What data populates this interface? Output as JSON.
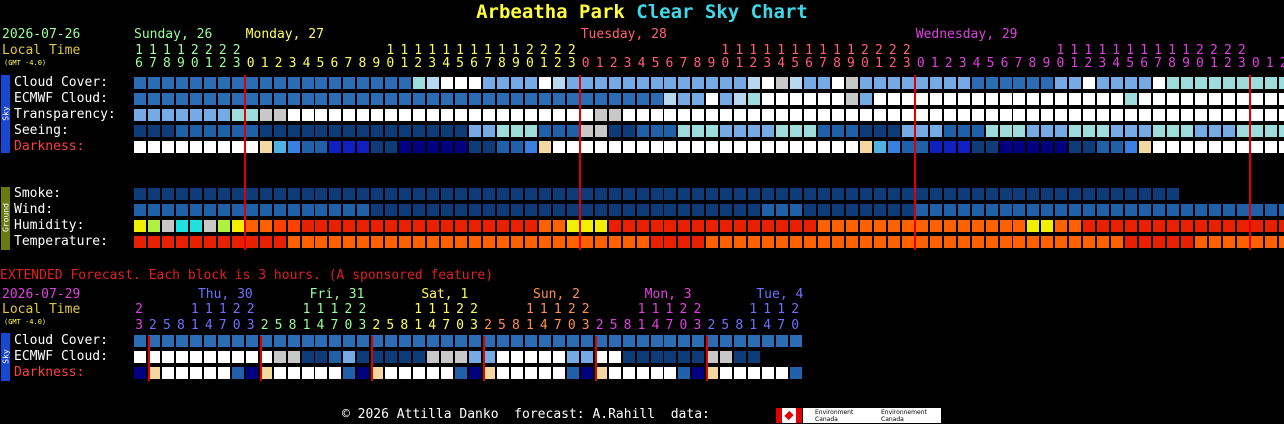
{
  "title": {
    "park": "Arbeatha Park",
    "chart": "Clear Sky Chart"
  },
  "main": {
    "date": "2026-07-26",
    "local_time": "Local Time",
    "gmt": "(GMT -4.0)",
    "days": [
      {
        "label": "Sunday, 26",
        "color": "#9cff9c"
      },
      {
        "label": "Monday, 27",
        "color": "#ffff60"
      },
      {
        "label": "Tuesday, 28",
        "color": "#ff6070"
      },
      {
        "label": "Wednesday, 29",
        "color": "#e040e0"
      }
    ],
    "hours": [
      16,
      17,
      18,
      19,
      20,
      21,
      22,
      23,
      0,
      1,
      2,
      3,
      4,
      5,
      6,
      7,
      8,
      9,
      10,
      11,
      12,
      13,
      14,
      15,
      16,
      17,
      18,
      19,
      20,
      21,
      22,
      23,
      0,
      1,
      2,
      3,
      4,
      5,
      6,
      7,
      8,
      9,
      10,
      11,
      12,
      13,
      14,
      15,
      16,
      17,
      18,
      19,
      20,
      21,
      22,
      23,
      0,
      1,
      2,
      3,
      4,
      5,
      6,
      7,
      8,
      9,
      10,
      11,
      12,
      13,
      14,
      15,
      16,
      17,
      18,
      19,
      20,
      21,
      22,
      23,
      0,
      1,
      2,
      3,
      4,
      5,
      6,
      7,
      8,
      9,
      10,
      11,
      12,
      13,
      14,
      15,
      16,
      17,
      18,
      19,
      20
    ],
    "day_index": [
      0,
      0,
      0,
      0,
      0,
      0,
      0,
      0,
      1,
      1,
      1,
      1,
      1,
      1,
      1,
      1,
      1,
      1,
      1,
      1,
      1,
      1,
      1,
      1,
      1,
      1,
      1,
      1,
      1,
      1,
      1,
      1,
      2,
      2,
      2,
      2,
      2,
      2,
      2,
      2,
      2,
      2,
      2,
      2,
      2,
      2,
      2,
      2,
      2,
      2,
      2,
      2,
      2,
      2,
      2,
      2,
      3,
      3,
      3,
      3,
      3,
      3,
      3,
      3,
      3,
      3,
      3,
      3,
      3,
      3,
      3,
      3,
      3,
      3,
      3,
      3,
      3,
      3,
      3,
      3,
      3,
      3,
      3,
      3,
      3,
      3,
      3,
      3,
      3,
      3,
      3,
      3,
      3,
      3,
      3,
      3,
      3,
      3,
      3,
      3,
      3,
      3,
      3
    ],
    "sky_label": "Sky",
    "ground_label": "Ground",
    "sky_rows": [
      {
        "label": "Cloud Cover:",
        "color": "#ffffff",
        "cells": "BBBBBBBBBBBBBBBBBBBBTSWWWLLLLWSLLLLLLLLLLLLLSWGSLLWGLLLLLLLLBBBBBBLLWLLLLWTTTTTTTTTTTTTTWWTTTTTTTTTTTTTWWWWWLGWWWWWWTLTLTLTLTL"
      },
      {
        "label": "ECMWF Cloud:",
        "color": "#ffffff",
        "cells": "BBBBBBBBBBBBBBBBBBBBBBBBBBBBBBBBBBBBBBSLLWLSTWWWWWWGLWWWWWWWWWWWWWWWWWWTWWWWWWWWWWWWWWWWWWWWWWWWWWWWWWWWWWWWWWWWWWWW"
      },
      {
        "label": "Transparency:",
        "color": "#ffffff",
        "cells": "LLLLLLLTTGGWWWWWWWWWWWWWWWWWWWWWWGGWWWWWWWWWWWWWWWWWWWWWWWWWWWWWWWWWWWWWWWWWWWWWWWWWWWWWWWWWWWWWWWWWWWWWWWWWWWWWWWGW"
      },
      {
        "label": "Seeing:",
        "color": "#ffffff",
        "cells": "DDDMMMMMMDDDDDDDDDDDDDDDLLTTTMMMGGDDMMMTTTLLLLTTTMMMDDDLLLMMMTTTLLLTTTLLLTTTLLLTTTTTTTT"
      },
      {
        "label": "Darkness:",
        "color": "#ff4040",
        "cells": "WWWWWWWWWPVaMMNNNDDXXXXXDDMMaPWWWWWWWWWWWWWWWWWWWWWWPVaMMNNNDDXXXXXDDMMaPWWWWWWWWWWWWWWWWWWWWWWPVaMMNNNDDXXXXXDDMMaPWWWWWWWWWWWWWWWWWWWWP"
      }
    ],
    "ground_rows": [
      {
        "label": "Smoke:",
        "color": "#ffffff",
        "cells": "DDDDDDDDDDDDDDDDDDDDDDDDDDDDDDDDDDDDDDDDDDDDDDDDDDDDDDDDDDDDDDDDDDDDDDDDDDD"
      },
      {
        "label": "Wind:",
        "color": "#ffffff",
        "cells": "MMMMMMMMMMMMMMMMMDDDDDDDDDDDDDDDDDDDDDDDDDDDDMMMDDDDDDDDMMMMMMMMMMMMMMMMMMMMMMMMMMMMMMMMMMMMMMMMMMMMMMMMMMM"
      },
      {
        "label": "Humidity:",
        "color": "#ffffff",
        "cells": "YHGCCGHYOOooRRRRRRRRRRRRRRRRROOYYYRRRRRRRRRRRRRRROOOOOOOOOOOOOOOYYOORRRRRRRRRRRRRRROOOOOYYHGOOR"
      },
      {
        "label": "Temperature:",
        "color": "#ffffff",
        "cells": "RRRRRRRRRRROOOOOOOOOOOOOOOOOOOOOOOOOORRRROOOOOOOOOOOOOOOOOOOOOOOOOOOOOORRRRROOOOOOOOOOOOOOOOOOOOOOOOOOORRRRRR"
      }
    ]
  },
  "extended": {
    "notice": "EXTENDED Forecast. Each block is 3 hours. (A sponsored feature)",
    "date": "2026-07-29",
    "local_time": "Local Time",
    "gmt": "(GMT -4.0)",
    "days": [
      {
        "label": "Thu, 30",
        "color": "#7070ff"
      },
      {
        "label": "Fri, 31",
        "color": "#9cff9c"
      },
      {
        "label": "Sat, 1",
        "color": "#ffff60"
      },
      {
        "label": "Sun, 2",
        "color": "#ff9050"
      },
      {
        "label": "Mon, 3",
        "color": "#e040e0"
      },
      {
        "label": "Tue, 4",
        "color": "#7070ff"
      }
    ],
    "hours": [
      23,
      2,
      5,
      8,
      11,
      14,
      17,
      20,
      23,
      2,
      5,
      8,
      11,
      14,
      17,
      20,
      23,
      2,
      5,
      8,
      11,
      14,
      17,
      20,
      23,
      2,
      5,
      8,
      11,
      14,
      17,
      20,
      23,
      2,
      5,
      8,
      11,
      14,
      17,
      20,
      23,
      2,
      5,
      8,
      11,
      14,
      17,
      20
    ],
    "day_index": [
      0,
      1,
      1,
      1,
      1,
      1,
      1,
      1,
      1,
      2,
      2,
      2,
      2,
      2,
      2,
      2,
      2,
      3,
      3,
      3,
      3,
      3,
      3,
      3,
      3,
      4,
      4,
      4,
      4,
      4,
      4,
      4,
      4,
      5,
      5,
      5,
      5,
      5,
      5,
      5,
      5,
      6,
      6,
      6,
      6,
      6,
      6,
      6
    ],
    "sky_label": "Sky",
    "rows": [
      {
        "label": "Cloud Cover:",
        "color": "#ffffff",
        "cells": "BBBBBBBBBBBBBBBBBBBBBBBBBBBBBBBBBBBBBBBBBBBBBBBB"
      },
      {
        "label": "ECMWF Cloud:",
        "color": "#ffffff",
        "cells": "WWWWWWWWWWGGDDMLDDDDDGGGLLWWWWWLLWWDDDDDDGGDD"
      },
      {
        "label": "Darkness:",
        "color": "#ff4040",
        "cells": "XPWWWWWMXPWWWWWMXPWWWWWMXPWWWWWMXPWWWWWMXPWWWWWM"
      }
    ]
  },
  "footer": {
    "copyright": "© 2026 Attilla Danko  forecast: A.Rahill  data:",
    "logo_text_1": "Environment Canada",
    "logo_text_2": "Environnement Canada"
  },
  "colors": {
    "B": "#2c6cb4",
    "D": "#0e3c78",
    "M": "#2060a8",
    "L": "#76aae4",
    "T": "#9edcdc",
    "S": "#b8d8f0",
    "W": "#ffffff",
    "G": "#c8c8c8",
    "P": "#f4d8a0",
    "V": "#50b0e0",
    "a": "#3880e0",
    "N": "#1020c0",
    "X": "#000080",
    "Y": "#f0f000",
    "H": "#b0f040",
    "C": "#20e0e0",
    "O": "#ff6000",
    "o": "#ff4000",
    "R": "#e82000"
  }
}
